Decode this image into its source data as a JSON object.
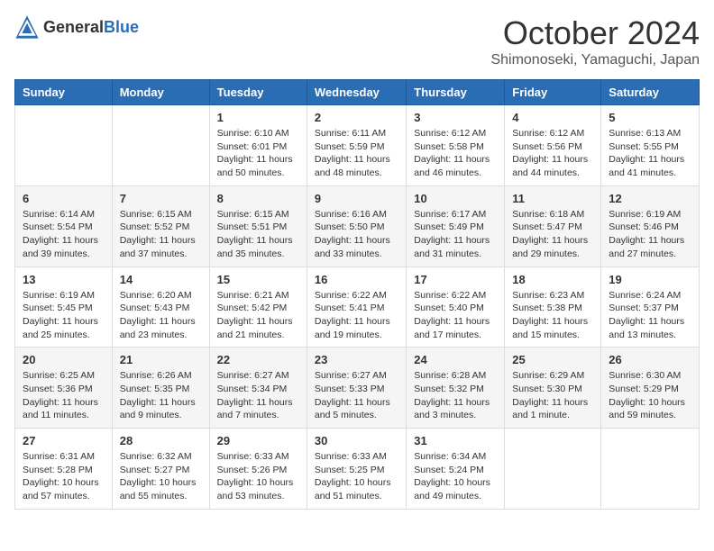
{
  "logo": {
    "general": "General",
    "blue": "Blue"
  },
  "title": "October 2024",
  "location": "Shimonoseki, Yamaguchi, Japan",
  "days_of_week": [
    "Sunday",
    "Monday",
    "Tuesday",
    "Wednesday",
    "Thursday",
    "Friday",
    "Saturday"
  ],
  "weeks": [
    [
      {
        "day": "",
        "detail": ""
      },
      {
        "day": "",
        "detail": ""
      },
      {
        "day": "1",
        "detail": "Sunrise: 6:10 AM\nSunset: 6:01 PM\nDaylight: 11 hours and 50 minutes."
      },
      {
        "day": "2",
        "detail": "Sunrise: 6:11 AM\nSunset: 5:59 PM\nDaylight: 11 hours and 48 minutes."
      },
      {
        "day": "3",
        "detail": "Sunrise: 6:12 AM\nSunset: 5:58 PM\nDaylight: 11 hours and 46 minutes."
      },
      {
        "day": "4",
        "detail": "Sunrise: 6:12 AM\nSunset: 5:56 PM\nDaylight: 11 hours and 44 minutes."
      },
      {
        "day": "5",
        "detail": "Sunrise: 6:13 AM\nSunset: 5:55 PM\nDaylight: 11 hours and 41 minutes."
      }
    ],
    [
      {
        "day": "6",
        "detail": "Sunrise: 6:14 AM\nSunset: 5:54 PM\nDaylight: 11 hours and 39 minutes."
      },
      {
        "day": "7",
        "detail": "Sunrise: 6:15 AM\nSunset: 5:52 PM\nDaylight: 11 hours and 37 minutes."
      },
      {
        "day": "8",
        "detail": "Sunrise: 6:15 AM\nSunset: 5:51 PM\nDaylight: 11 hours and 35 minutes."
      },
      {
        "day": "9",
        "detail": "Sunrise: 6:16 AM\nSunset: 5:50 PM\nDaylight: 11 hours and 33 minutes."
      },
      {
        "day": "10",
        "detail": "Sunrise: 6:17 AM\nSunset: 5:49 PM\nDaylight: 11 hours and 31 minutes."
      },
      {
        "day": "11",
        "detail": "Sunrise: 6:18 AM\nSunset: 5:47 PM\nDaylight: 11 hours and 29 minutes."
      },
      {
        "day": "12",
        "detail": "Sunrise: 6:19 AM\nSunset: 5:46 PM\nDaylight: 11 hours and 27 minutes."
      }
    ],
    [
      {
        "day": "13",
        "detail": "Sunrise: 6:19 AM\nSunset: 5:45 PM\nDaylight: 11 hours and 25 minutes."
      },
      {
        "day": "14",
        "detail": "Sunrise: 6:20 AM\nSunset: 5:43 PM\nDaylight: 11 hours and 23 minutes."
      },
      {
        "day": "15",
        "detail": "Sunrise: 6:21 AM\nSunset: 5:42 PM\nDaylight: 11 hours and 21 minutes."
      },
      {
        "day": "16",
        "detail": "Sunrise: 6:22 AM\nSunset: 5:41 PM\nDaylight: 11 hours and 19 minutes."
      },
      {
        "day": "17",
        "detail": "Sunrise: 6:22 AM\nSunset: 5:40 PM\nDaylight: 11 hours and 17 minutes."
      },
      {
        "day": "18",
        "detail": "Sunrise: 6:23 AM\nSunset: 5:38 PM\nDaylight: 11 hours and 15 minutes."
      },
      {
        "day": "19",
        "detail": "Sunrise: 6:24 AM\nSunset: 5:37 PM\nDaylight: 11 hours and 13 minutes."
      }
    ],
    [
      {
        "day": "20",
        "detail": "Sunrise: 6:25 AM\nSunset: 5:36 PM\nDaylight: 11 hours and 11 minutes."
      },
      {
        "day": "21",
        "detail": "Sunrise: 6:26 AM\nSunset: 5:35 PM\nDaylight: 11 hours and 9 minutes."
      },
      {
        "day": "22",
        "detail": "Sunrise: 6:27 AM\nSunset: 5:34 PM\nDaylight: 11 hours and 7 minutes."
      },
      {
        "day": "23",
        "detail": "Sunrise: 6:27 AM\nSunset: 5:33 PM\nDaylight: 11 hours and 5 minutes."
      },
      {
        "day": "24",
        "detail": "Sunrise: 6:28 AM\nSunset: 5:32 PM\nDaylight: 11 hours and 3 minutes."
      },
      {
        "day": "25",
        "detail": "Sunrise: 6:29 AM\nSunset: 5:30 PM\nDaylight: 11 hours and 1 minute."
      },
      {
        "day": "26",
        "detail": "Sunrise: 6:30 AM\nSunset: 5:29 PM\nDaylight: 10 hours and 59 minutes."
      }
    ],
    [
      {
        "day": "27",
        "detail": "Sunrise: 6:31 AM\nSunset: 5:28 PM\nDaylight: 10 hours and 57 minutes."
      },
      {
        "day": "28",
        "detail": "Sunrise: 6:32 AM\nSunset: 5:27 PM\nDaylight: 10 hours and 55 minutes."
      },
      {
        "day": "29",
        "detail": "Sunrise: 6:33 AM\nSunset: 5:26 PM\nDaylight: 10 hours and 53 minutes."
      },
      {
        "day": "30",
        "detail": "Sunrise: 6:33 AM\nSunset: 5:25 PM\nDaylight: 10 hours and 51 minutes."
      },
      {
        "day": "31",
        "detail": "Sunrise: 6:34 AM\nSunset: 5:24 PM\nDaylight: 10 hours and 49 minutes."
      },
      {
        "day": "",
        "detail": ""
      },
      {
        "day": "",
        "detail": ""
      }
    ]
  ]
}
